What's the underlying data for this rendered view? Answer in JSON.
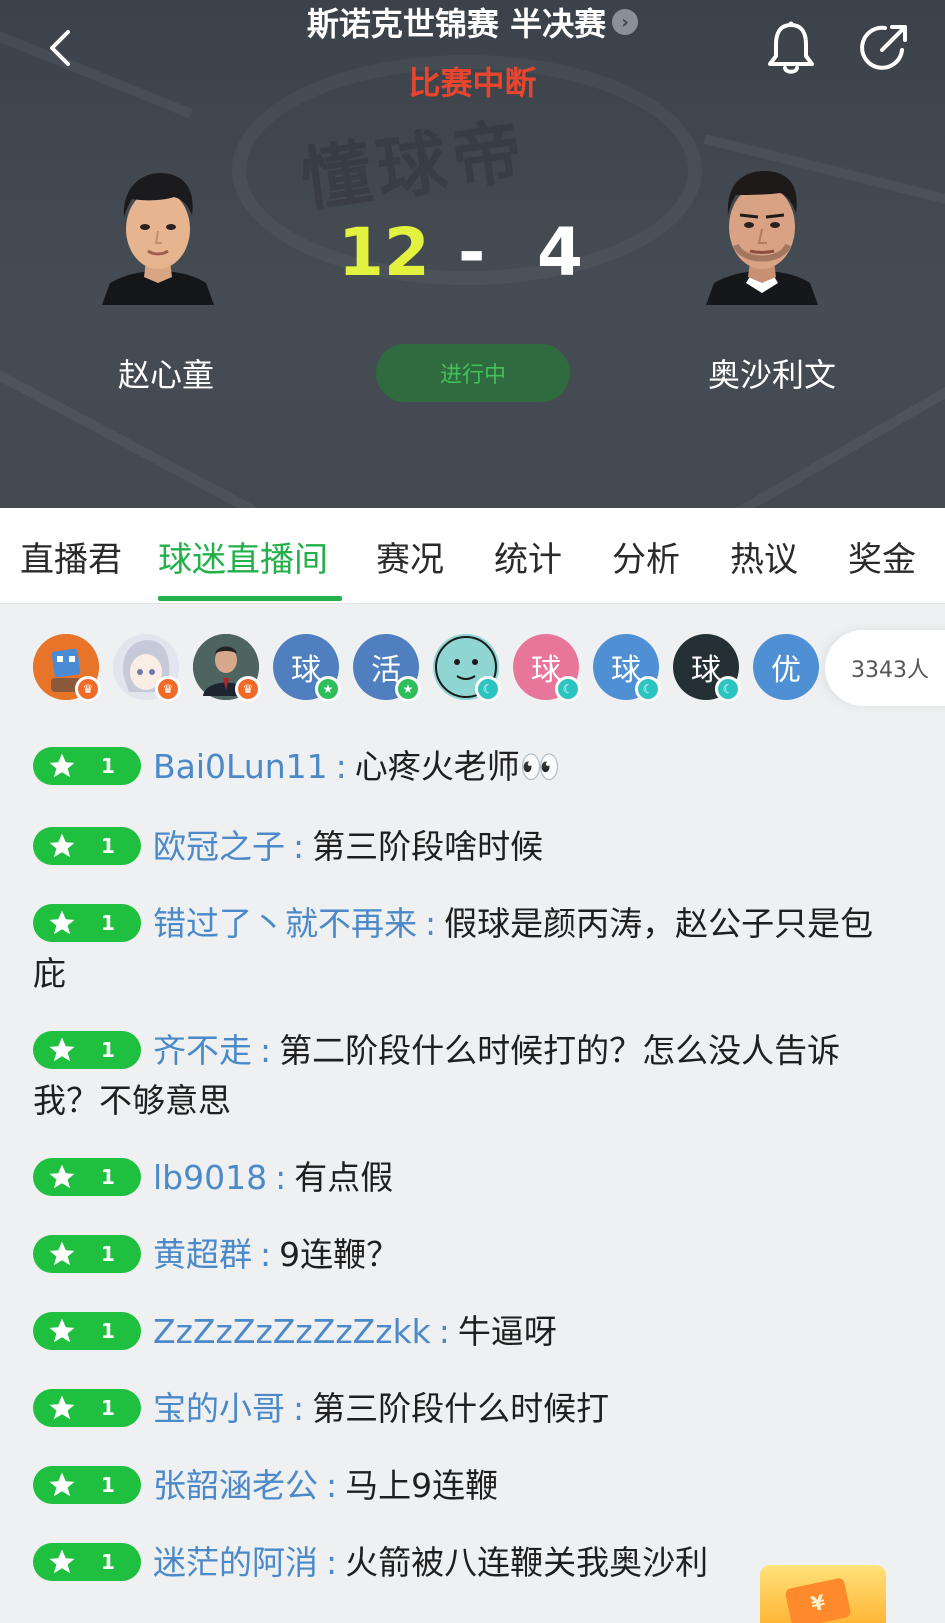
{
  "header": {
    "title": "斯诺克世锦赛 半决赛",
    "status": "比赛中断",
    "score_left": "12",
    "score_separator": "-",
    "score_right": "4",
    "live_label": "进行中",
    "player_left": "赵心童",
    "player_right": "奥沙利文",
    "watermark": "懂球帝"
  },
  "tabs": [
    "直播君",
    "球迷直播间",
    "赛况",
    "统计",
    "分析",
    "热议",
    "奖金"
  ],
  "active_tab": "球迷直播间",
  "viewers": {
    "avatars": [
      {
        "char": "",
        "badge": "crown"
      },
      {
        "char": "",
        "badge": "crown"
      },
      {
        "char": "",
        "badge": "crown"
      },
      {
        "char": "球",
        "badge": "star"
      },
      {
        "char": "活",
        "badge": "star"
      },
      {
        "char": "",
        "badge": "moon"
      },
      {
        "char": "球",
        "badge": "moon"
      },
      {
        "char": "球",
        "badge": "moon"
      },
      {
        "char": "球",
        "badge": "moon"
      },
      {
        "char": "优",
        "badge": ""
      }
    ],
    "count": "3343人"
  },
  "messages": [
    {
      "level": "1",
      "user": "Bai0Lun11",
      "text": "心疼火老师👀"
    },
    {
      "level": "1",
      "user": "欧冠之子",
      "text": "第三阶段啥时候"
    },
    {
      "level": "1",
      "user": "错过了丶就不再来",
      "text": "假球是颜丙涛，赵公子只是包庇"
    },
    {
      "level": "1",
      "user": "齐不走",
      "text": "第二阶段什么时候打的？怎么没人告诉我？不够意思"
    },
    {
      "level": "1",
      "user": "lb9018",
      "text": "有点假"
    },
    {
      "level": "1",
      "user": "黄超群",
      "text": "9连鞭？"
    },
    {
      "level": "1",
      "user": "ZzZzZzZzZzZzkk",
      "text": "牛逼呀"
    },
    {
      "level": "1",
      "user": "宝的小哥",
      "text": "第三阶段什么时候打"
    },
    {
      "level": "1",
      "user": "张韶涵老公",
      "text": "马上9连鞭"
    },
    {
      "level": "1",
      "user": "迷茫的阿消",
      "text": "火箭被八连鞭关我奥沙利"
    }
  ],
  "colors": {
    "accent_green": "#23b04a",
    "score_yellow": "#e2f23f",
    "status_red": "#e8452e",
    "username_blue": "#4b89c9",
    "level_badge_green": "#1fbf3f"
  },
  "redpacket_symbol": "¥"
}
